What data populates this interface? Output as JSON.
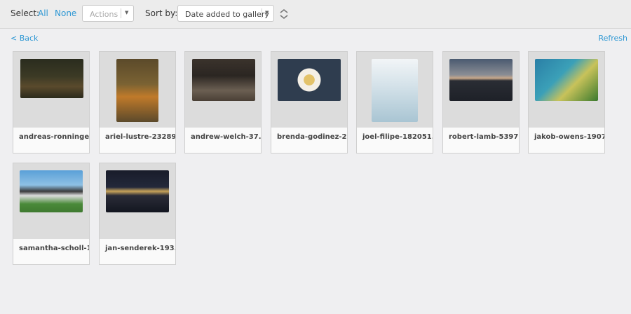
{
  "toolbar": {
    "select_label": "Select:",
    "select_all": "All",
    "select_none": "None",
    "actions_placeholder": "Actions",
    "sort_label": "Sort by:",
    "sort_value": "Date added to gallery"
  },
  "nav": {
    "back": "< Back",
    "refresh": "Refresh"
  },
  "gallery": {
    "items": [
      {
        "name": "andreas-ronninge..."
      },
      {
        "name": "ariel-lustre-23289..."
      },
      {
        "name": "andrew-welch-37..."
      },
      {
        "name": "brenda-godinez-2..."
      },
      {
        "name": "joel-filipe-182051..."
      },
      {
        "name": "robert-lamb-5397..."
      },
      {
        "name": "jakob-owens-1907..."
      },
      {
        "name": "samantha-scholl-1..."
      },
      {
        "name": "jan-senderek-193..."
      }
    ]
  }
}
